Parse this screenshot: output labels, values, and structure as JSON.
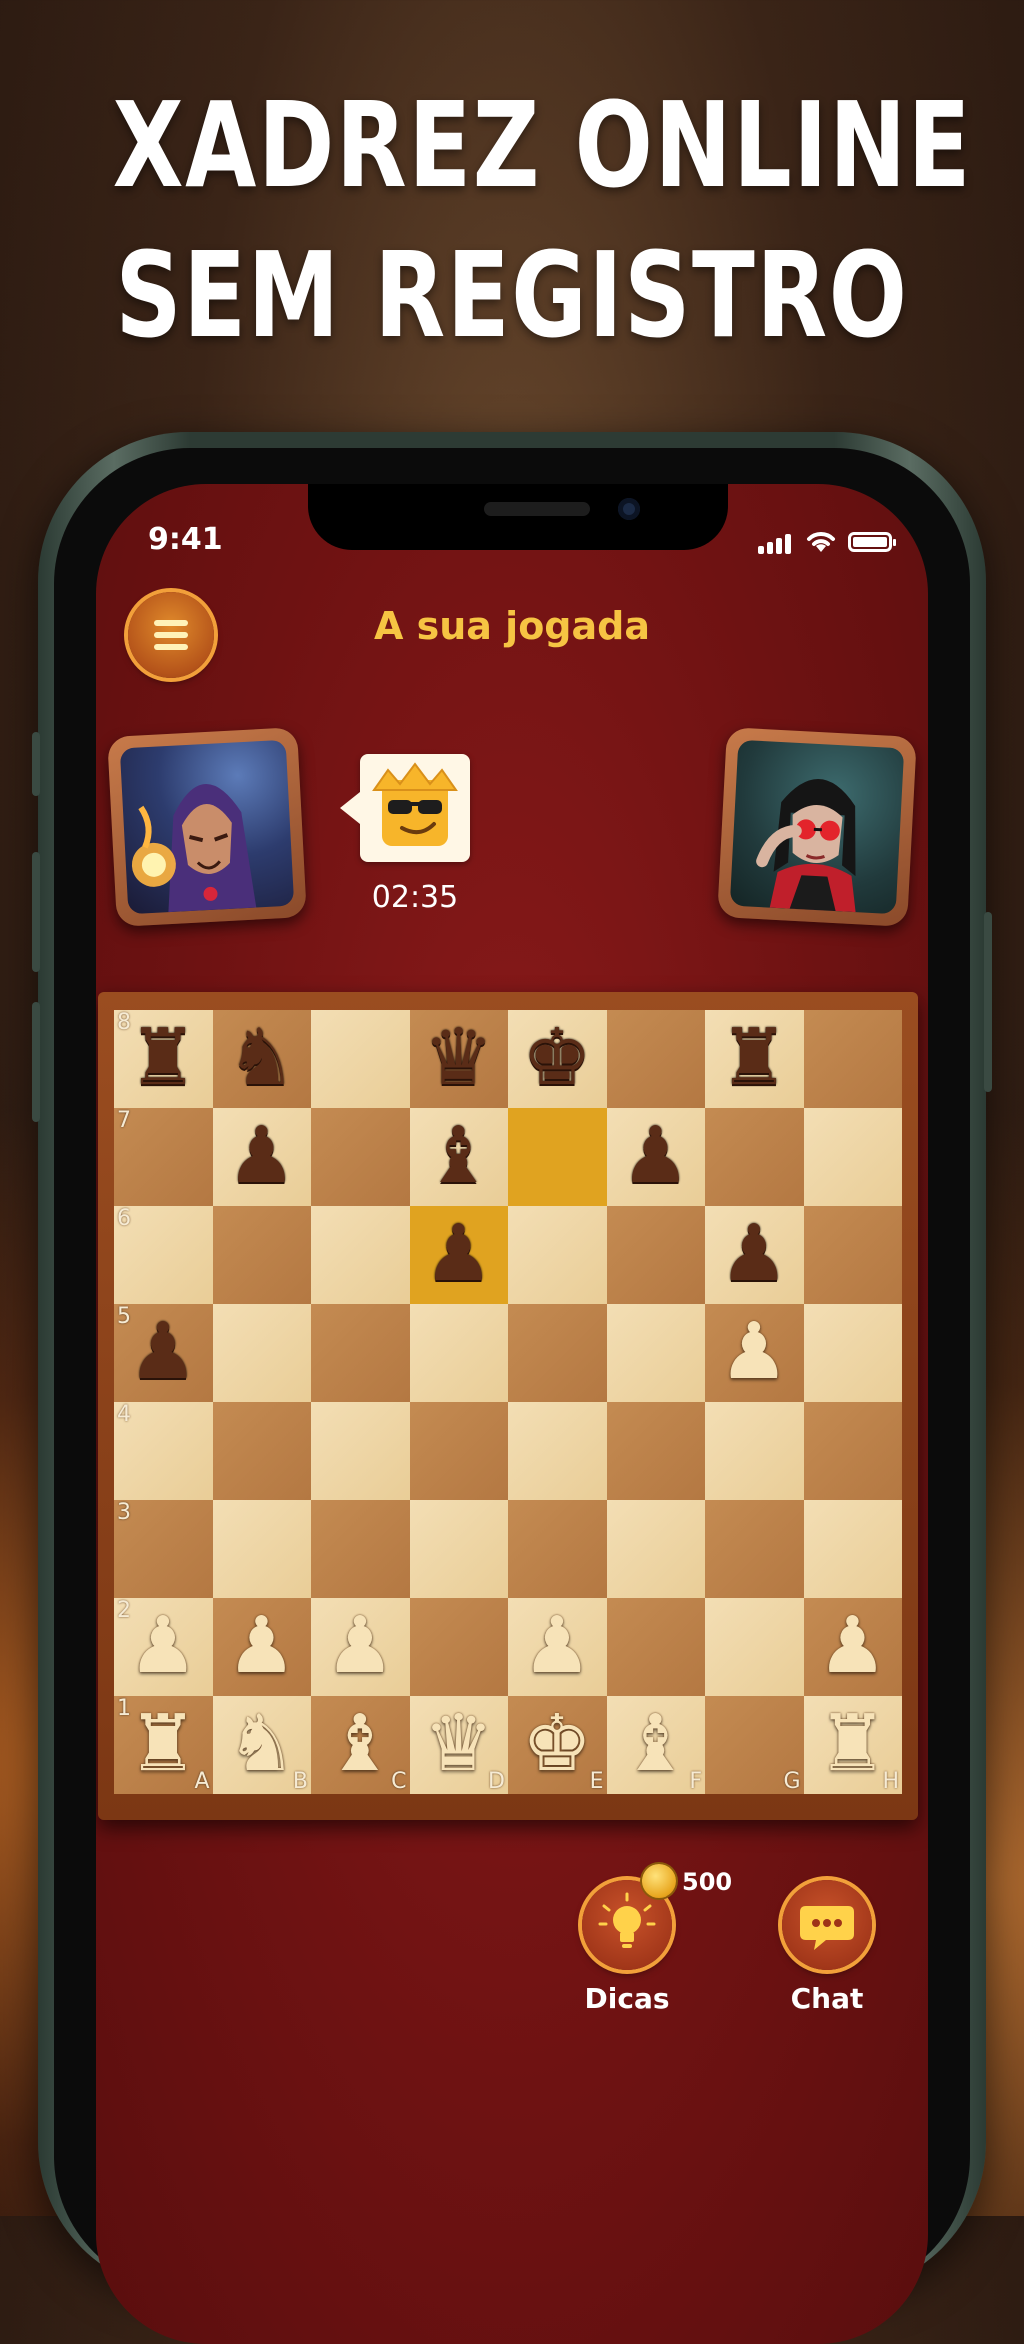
{
  "headline": {
    "line1": "XADREZ ONLINE",
    "line2": "SEM REGISTRO"
  },
  "status_bar": {
    "time": "9:41",
    "icons": [
      "cellular-signal-icon",
      "wifi-icon",
      "battery-icon"
    ]
  },
  "game": {
    "turn_title": "A sua jogada",
    "menu_icon": "hamburger-menu-icon",
    "player": {
      "avatar": "hooded-wizard-avatar"
    },
    "opponent": {
      "avatar": "red-glasses-man-avatar"
    },
    "emoji": "cool-crown-emoji-icon",
    "timer": "02:35"
  },
  "board": {
    "ranks": [
      "8",
      "7",
      "6",
      "5",
      "4",
      "3",
      "2",
      "1"
    ],
    "files": [
      "A",
      "B",
      "C",
      "D",
      "E",
      "F",
      "G",
      "H"
    ],
    "highlight_squares": [
      "d6",
      "e7"
    ],
    "position": [
      [
        "br",
        "bn",
        "",
        "bq",
        "bk",
        "",
        "br",
        ""
      ],
      [
        "",
        "bp",
        "",
        "bb",
        "",
        "bp",
        "",
        ""
      ],
      [
        "",
        "",
        "",
        "bp",
        "",
        "",
        "bp",
        ""
      ],
      [
        "bp",
        "",
        "",
        "",
        "",
        "",
        "wp",
        ""
      ],
      [
        "",
        "",
        "",
        "",
        "",
        "",
        "",
        ""
      ],
      [
        "",
        "",
        "",
        "",
        "",
        "",
        "",
        ""
      ],
      [
        "wp",
        "wp",
        "wp",
        "",
        "wp",
        "",
        "",
        "wp"
      ],
      [
        "wr",
        "wn",
        "wb",
        "wq",
        "wk",
        "wb",
        "",
        "wr"
      ]
    ]
  },
  "actions": {
    "hints": {
      "label": "Dicas",
      "icon": "lightbulb-icon",
      "coin_icon": "coin-icon",
      "cost": "500"
    },
    "chat": {
      "label": "Chat",
      "icon": "chat-bubble-icon"
    }
  },
  "colors": {
    "accent": "#f6c443",
    "screen_bg": "#6e1212",
    "button_ring": "#f2a03a",
    "highlight": "#f5c333"
  }
}
